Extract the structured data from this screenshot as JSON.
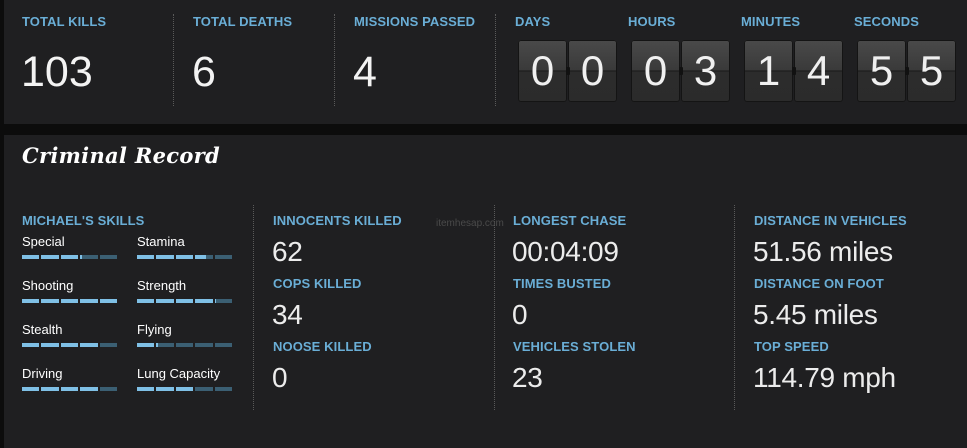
{
  "top": {
    "total_kills": {
      "label": "TOTAL KILLS",
      "value": "103"
    },
    "total_deaths": {
      "label": "TOTAL DEATHS",
      "value": "6"
    },
    "missions_passed": {
      "label": "MISSIONS PASSED",
      "value": "4"
    },
    "timer": [
      {
        "label": "DAYS",
        "digits": [
          "0",
          "0"
        ]
      },
      {
        "label": "HOURS",
        "digits": [
          "0",
          "3"
        ]
      },
      {
        "label": "MINUTES",
        "digits": [
          "1",
          "4"
        ]
      },
      {
        "label": "SECONDS",
        "digits": [
          "5",
          "5"
        ]
      }
    ]
  },
  "record": {
    "title": "Criminal Record",
    "skills": {
      "label": "MICHAEL'S SKILLS",
      "items": [
        {
          "name": "Special",
          "level": 0.62
        },
        {
          "name": "Stamina",
          "level": 0.72
        },
        {
          "name": "Shooting",
          "level": 1.0
        },
        {
          "name": "Strength",
          "level": 0.82
        },
        {
          "name": "Stealth",
          "level": 0.8
        },
        {
          "name": "Flying",
          "level": 0.22
        },
        {
          "name": "Driving",
          "level": 0.8
        },
        {
          "name": "Lung Capacity",
          "level": 0.6
        }
      ]
    },
    "col2": [
      {
        "label": "INNOCENTS KILLED",
        "value": "62"
      },
      {
        "label": "COPS KILLED",
        "value": "34"
      },
      {
        "label": "NOOSE KILLED",
        "value": "0"
      }
    ],
    "col3": [
      {
        "label": "LONGEST CHASE",
        "value": "00:04:09"
      },
      {
        "label": "TIMES BUSTED",
        "value": "0"
      },
      {
        "label": "VEHICLES STOLEN",
        "value": "23"
      }
    ],
    "col4": [
      {
        "label": "DISTANCE IN VEHICLES",
        "value": "51.56 miles"
      },
      {
        "label": "DISTANCE ON FOOT",
        "value": "5.45 miles"
      },
      {
        "label": "TOP SPEED",
        "value": "114.79 mph"
      }
    ]
  },
  "watermark": "itemhesap.com",
  "colors": {
    "accent": "#6aaed6",
    "bar_fill": "#7fc0e6",
    "bar_empty": "#3b5f73",
    "panel": "#1f1f21"
  }
}
